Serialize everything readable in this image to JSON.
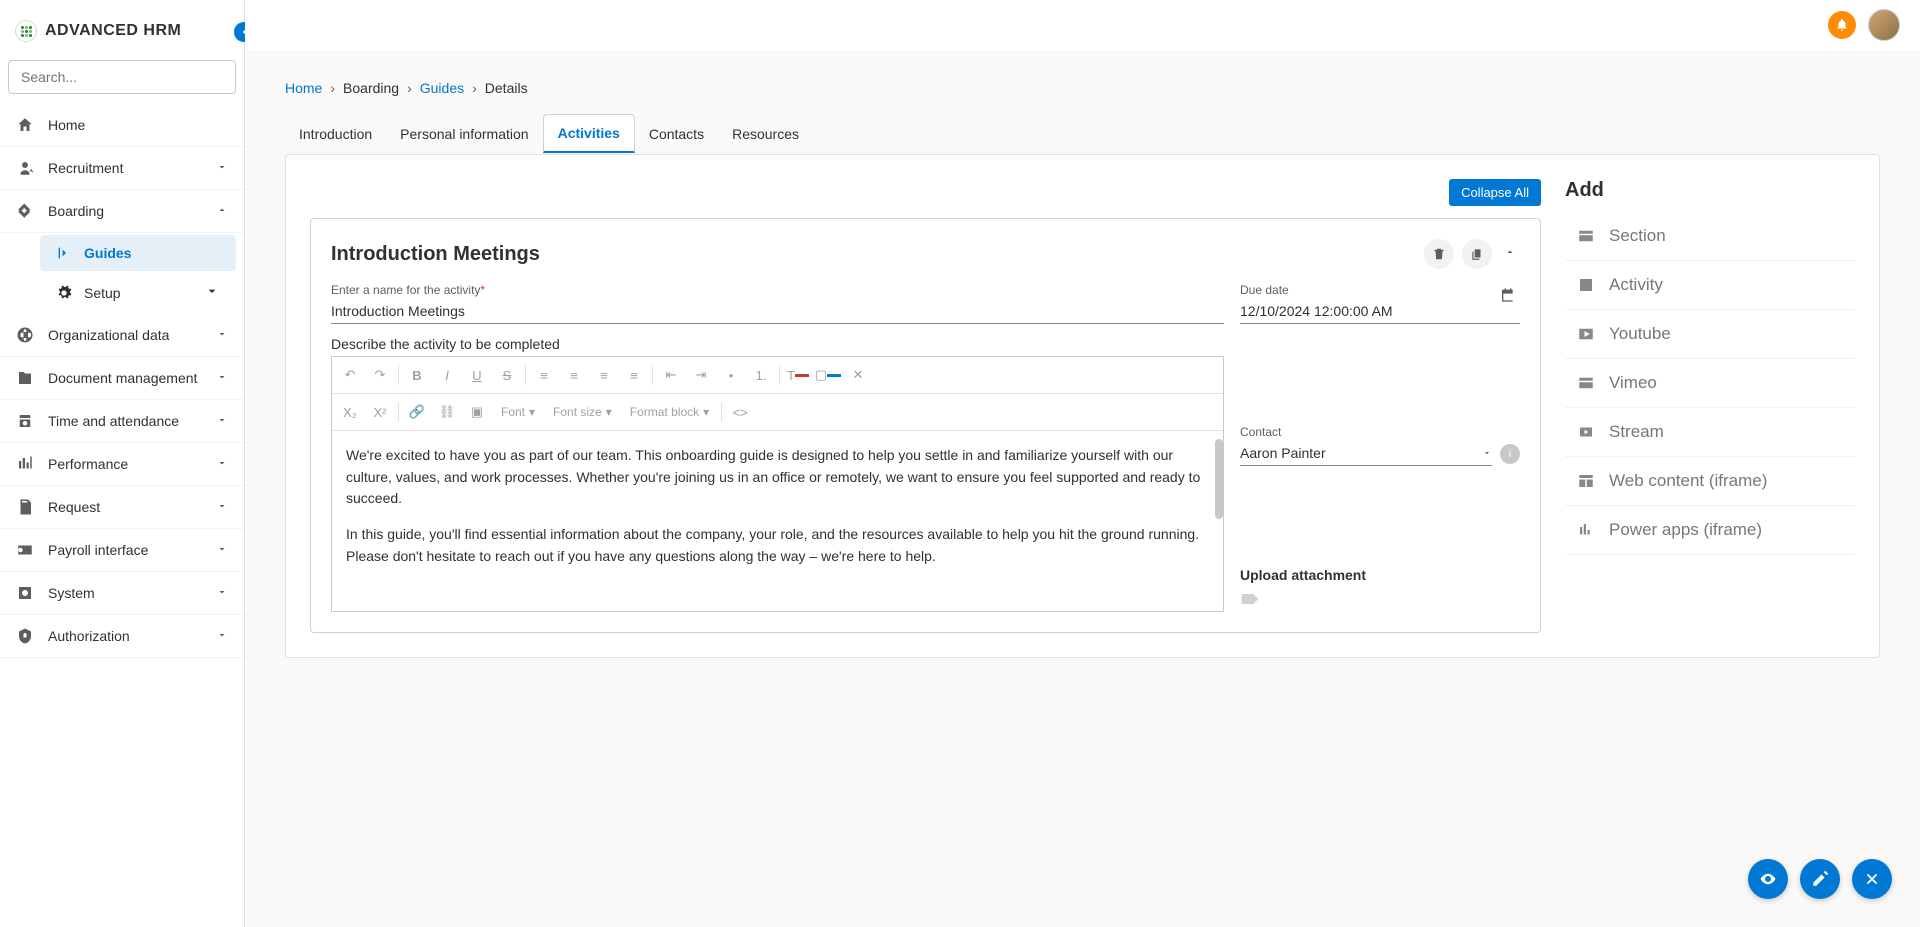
{
  "app": {
    "title": "ADVANCED HRM"
  },
  "search": {
    "placeholder": "Search..."
  },
  "sidebar": {
    "items": [
      {
        "label": "Home"
      },
      {
        "label": "Recruitment"
      },
      {
        "label": "Boarding"
      },
      {
        "label": "Organizational data"
      },
      {
        "label": "Document management"
      },
      {
        "label": "Time and attendance"
      },
      {
        "label": "Performance"
      },
      {
        "label": "Request"
      },
      {
        "label": "Payroll interface"
      },
      {
        "label": "System"
      },
      {
        "label": "Authorization"
      }
    ],
    "boarding_children": [
      {
        "label": "Guides"
      },
      {
        "label": "Setup"
      }
    ]
  },
  "breadcrumb": {
    "home": "Home",
    "boarding": "Boarding",
    "guides": "Guides",
    "details": "Details"
  },
  "tabs": [
    {
      "label": "Introduction"
    },
    {
      "label": "Personal information"
    },
    {
      "label": "Activities"
    },
    {
      "label": "Contacts"
    },
    {
      "label": "Resources"
    }
  ],
  "buttons": {
    "collapse_all": "Collapse All"
  },
  "card": {
    "title": "Introduction Meetings",
    "name_label": "Enter a name for the activity",
    "name_value": "Introduction Meetings",
    "due_label": "Due date",
    "due_value": "12/10/2024 12:00:00 AM",
    "contact_label": "Contact",
    "contact_value": "Aaron Painter",
    "describe_label": "Describe the activity to be completed",
    "upload_label": "Upload attachment"
  },
  "editor": {
    "font_label": "Font",
    "fontsize_label": "Font size",
    "format_label": "Format block",
    "para1": "We're excited to have you as part of our team. This onboarding guide is designed to help you settle in and familiarize yourself with our culture, values, and work processes. Whether you're joining us in an office or remotely, we want to ensure you feel supported and ready to succeed.",
    "para2": "In this guide, you'll find essential information about the company, your role, and the resources available to help you hit the ground running. Please don't hesitate to reach out if you have any questions along the way – we're here to help."
  },
  "add": {
    "title": "Add",
    "items": [
      {
        "label": "Section"
      },
      {
        "label": "Activity"
      },
      {
        "label": "Youtube"
      },
      {
        "label": "Vimeo"
      },
      {
        "label": "Stream"
      },
      {
        "label": "Web content (iframe)"
      },
      {
        "label": "Power apps (iframe)"
      }
    ]
  }
}
